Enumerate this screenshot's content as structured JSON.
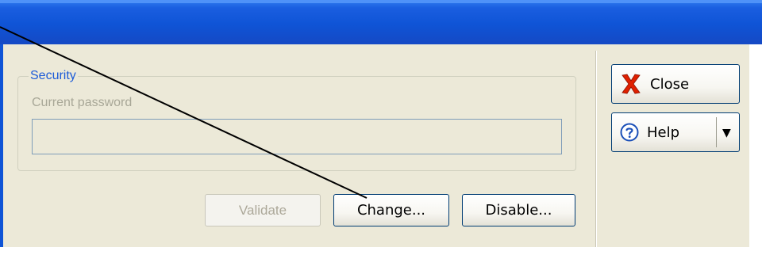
{
  "security": {
    "title": "Security",
    "current_password_label": "Current password",
    "current_password_value": ""
  },
  "buttons": {
    "validate_label": "Validate",
    "change_label": "Change...",
    "disable_label": "Disable...",
    "close_label": "Close",
    "help_label": "Help"
  },
  "icons": {
    "close": "close-x-icon",
    "help": "help-question-icon",
    "help_dropdown": "chevron-down-icon"
  },
  "colors": {
    "titlebar": "#0f54d6",
    "dialog_bg": "#ece9d8",
    "group_title": "#1c5bd8",
    "close_icon": "#e02000",
    "help_icon": "#2a6ad8"
  }
}
